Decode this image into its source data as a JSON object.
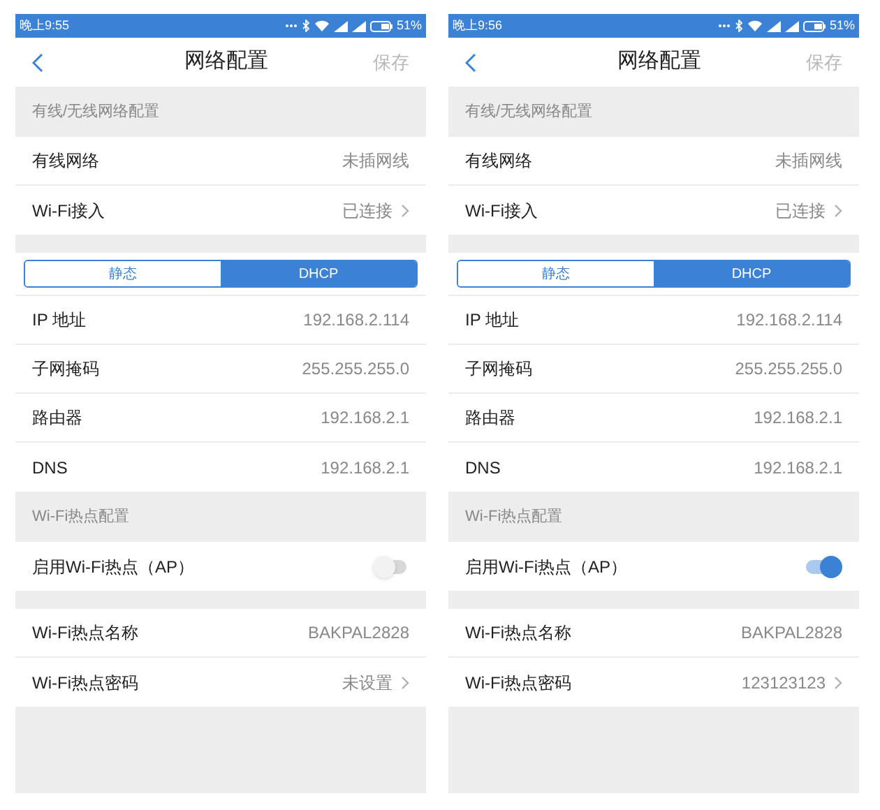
{
  "screens": [
    {
      "status_bar": {
        "time": "晚上9:55",
        "battery": "51%"
      },
      "nav": {
        "title": "网络配置",
        "action": "保存"
      },
      "sections": [
        {
          "header": "有线/无线网络配置",
          "rows": [
            {
              "kind": "value",
              "label": "有线网络",
              "value": "未插网线",
              "chevron": false
            },
            {
              "kind": "value",
              "label": "Wi-Fi接入",
              "value": "已连接",
              "chevron": true
            }
          ]
        },
        {
          "rows": [
            {
              "kind": "segment",
              "options": [
                {
                  "label": "静态",
                  "selected": false
                },
                {
                  "label": "DHCP",
                  "selected": true
                }
              ]
            },
            {
              "kind": "value",
              "label": "IP 地址",
              "value": "192.168.2.114",
              "chevron": false
            },
            {
              "kind": "value",
              "label": "子网掩码",
              "value": "255.255.255.0",
              "chevron": false
            },
            {
              "kind": "value",
              "label": "路由器",
              "value": "192.168.2.1",
              "chevron": false
            },
            {
              "kind": "value",
              "label": "DNS",
              "value": "192.168.2.1",
              "chevron": false
            }
          ]
        },
        {
          "header": "Wi-Fi热点配置",
          "rows": [
            {
              "kind": "toggle",
              "label": "启用Wi-Fi热点（AP）",
              "on": false
            }
          ]
        },
        {
          "rows": [
            {
              "kind": "value",
              "label": "Wi-Fi热点名称",
              "value": "BAKPAL2828",
              "chevron": false
            },
            {
              "kind": "value",
              "label": "Wi-Fi热点密码",
              "value": "未设置",
              "chevron": true
            }
          ]
        }
      ]
    },
    {
      "status_bar": {
        "time": "晚上9:56",
        "battery": "51%"
      },
      "nav": {
        "title": "网络配置",
        "action": "保存"
      },
      "sections": [
        {
          "header": "有线/无线网络配置",
          "rows": [
            {
              "kind": "value",
              "label": "有线网络",
              "value": "未插网线",
              "chevron": false
            },
            {
              "kind": "value",
              "label": "Wi-Fi接入",
              "value": "已连接",
              "chevron": true
            }
          ]
        },
        {
          "rows": [
            {
              "kind": "segment",
              "options": [
                {
                  "label": "静态",
                  "selected": false
                },
                {
                  "label": "DHCP",
                  "selected": true
                }
              ]
            },
            {
              "kind": "value",
              "label": "IP 地址",
              "value": "192.168.2.114",
              "chevron": false
            },
            {
              "kind": "value",
              "label": "子网掩码",
              "value": "255.255.255.0",
              "chevron": false
            },
            {
              "kind": "value",
              "label": "路由器",
              "value": "192.168.2.1",
              "chevron": false
            },
            {
              "kind": "value",
              "label": "DNS",
              "value": "192.168.2.1",
              "chevron": false
            }
          ]
        },
        {
          "header": "Wi-Fi热点配置",
          "rows": [
            {
              "kind": "toggle",
              "label": "启用Wi-Fi热点（AP）",
              "on": true
            }
          ]
        },
        {
          "rows": [
            {
              "kind": "value",
              "label": "Wi-Fi热点名称",
              "value": "BAKPAL2828",
              "chevron": false
            },
            {
              "kind": "value",
              "label": "Wi-Fi热点密码",
              "value": "123123123",
              "chevron": true
            }
          ]
        }
      ]
    }
  ]
}
